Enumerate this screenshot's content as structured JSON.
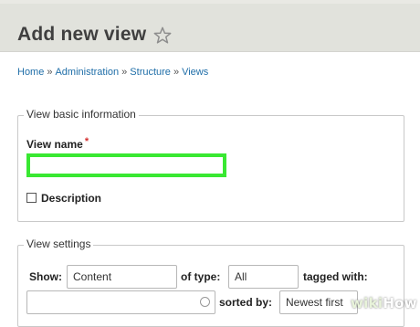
{
  "header": {
    "title": "Add new view"
  },
  "breadcrumb": {
    "items": [
      "Home",
      "Administration",
      "Structure",
      "Views"
    ],
    "separator": "»"
  },
  "basic_info": {
    "legend": "View basic information",
    "view_name_label": "View name",
    "required_marker": "*",
    "view_name_value": "",
    "description_label": "Description",
    "description_checked": false,
    "highlight_color": "#39e832"
  },
  "view_settings": {
    "legend": "View settings",
    "show_label": "Show:",
    "show_value": "Content",
    "of_type_label": "of type:",
    "of_type_value": "All",
    "tagged_with_label": "tagged with:",
    "tagged_with_value": "",
    "sorted_by_label": "sorted by:",
    "sorted_by_value": "Newest first"
  },
  "watermark": {
    "part1": "wiki",
    "part2": "How"
  },
  "icons": {
    "title_icon": "star-outline-icon",
    "checkbox": "checkbox-unchecked",
    "autocomplete": "throbber-icon"
  }
}
